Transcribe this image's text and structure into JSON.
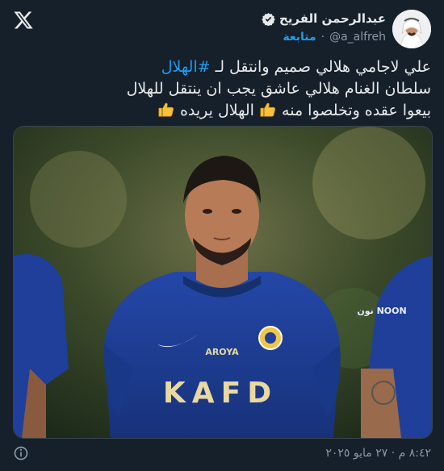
{
  "author": {
    "display_name": "عبدالرحمن الفريح",
    "handle": "@a_alfreh",
    "follow_label": "متابعة",
    "separator": "·"
  },
  "tweet": {
    "line1_text": "علي لاجامي هلالي صميم وانتقل لـ",
    "line1_hashtag": "#الهلال",
    "line2": "سلطان الغنام هلالي عاشق يجب ان ينتقل للهلال",
    "line3_a": "بيعوا عقده وتخلصوا منه",
    "line3_b": "الهلال يريده"
  },
  "media": {
    "sponsor_text": "KAFD",
    "brand_text": "AROYA",
    "side_text": "نون NOON"
  },
  "footer": {
    "timestamp": "٨:٤٢ م · ٢٧ مايو ٢٠٢٥"
  },
  "icons": {
    "logo": "x-logo-icon",
    "verified": "verified-badge-icon",
    "emoji": "thumbs-up-emoji",
    "info": "info-icon"
  },
  "colors": {
    "background": "#15202b",
    "accent": "#1d9bf0",
    "secondary_text": "#8b98a5",
    "jersey": "#1f3f9a"
  }
}
